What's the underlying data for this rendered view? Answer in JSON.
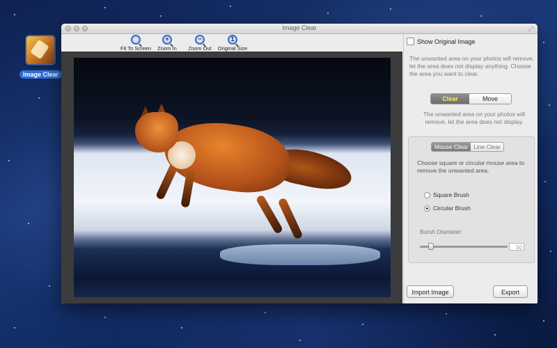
{
  "desktop": {
    "app_icon_label": "Image Clear"
  },
  "window": {
    "title": "Image Clear"
  },
  "toolbar": {
    "items": [
      {
        "label": "Fit To Screen",
        "icon": "magnifier-fit-icon"
      },
      {
        "label": "Zoom In",
        "icon": "zoom-in-icon"
      },
      {
        "label": "Zoom Out",
        "icon": "zoom-out-icon"
      },
      {
        "label": "Original Size",
        "icon": "magnifier-original-icon"
      }
    ]
  },
  "panel": {
    "show_original_label": "Show Original Image",
    "show_original_checked": false,
    "intro_text": "The unwanted area on your photos will remove, let the area does not display anything. Choose the area you want to clear.",
    "mode_segment": {
      "selected": "Clear",
      "options": [
        "Clear",
        "Move"
      ]
    },
    "mode_description": "The unwanted area on your photos will remove, let the area does not display.",
    "clear_type_segment": {
      "selected": "Mouse Clear",
      "options": [
        "Mouse Clear",
        "Line Clear"
      ]
    },
    "clear_type_description": "Choose square or circular mouse area to remove the unwanted area.",
    "brush_options": [
      {
        "label": "Square Brush",
        "selected": false
      },
      {
        "label": "Circular Brush",
        "selected": true
      }
    ],
    "diameter_label": "Bursh Diameter:",
    "diameter_value": "50",
    "diameter_fraction": 0.1,
    "import_button": "Import Image",
    "export_button": "Export"
  },
  "colors": {
    "selected_segment_text": "#f4ef5a",
    "canvas_bg": "#3c3c3c",
    "selection_blue": "#2f6fd6"
  }
}
